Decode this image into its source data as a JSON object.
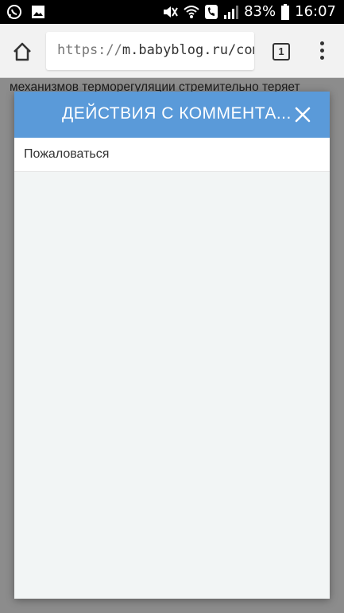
{
  "status_bar": {
    "battery": "83%",
    "time": "16:07",
    "left_icons": [
      "whatsapp-icon",
      "image-icon"
    ],
    "right_icons": [
      "mute-icon",
      "wifi-icon",
      "call-icon",
      "signal-icon",
      "battery-icon"
    ]
  },
  "browser": {
    "url_protocol": "https://",
    "url_host": "m.babyblog.ru/comm",
    "tab_count": "1"
  },
  "page": {
    "text_line": "механизмов терморегуляции стремительно теряет"
  },
  "modal": {
    "title": "ДЕЙСТВИЯ С КОММЕНТА...",
    "items": [
      {
        "label": "Пожаловаться"
      }
    ]
  },
  "colors": {
    "header": "#5a9ad9",
    "modal_bg": "#f2f5f5"
  }
}
